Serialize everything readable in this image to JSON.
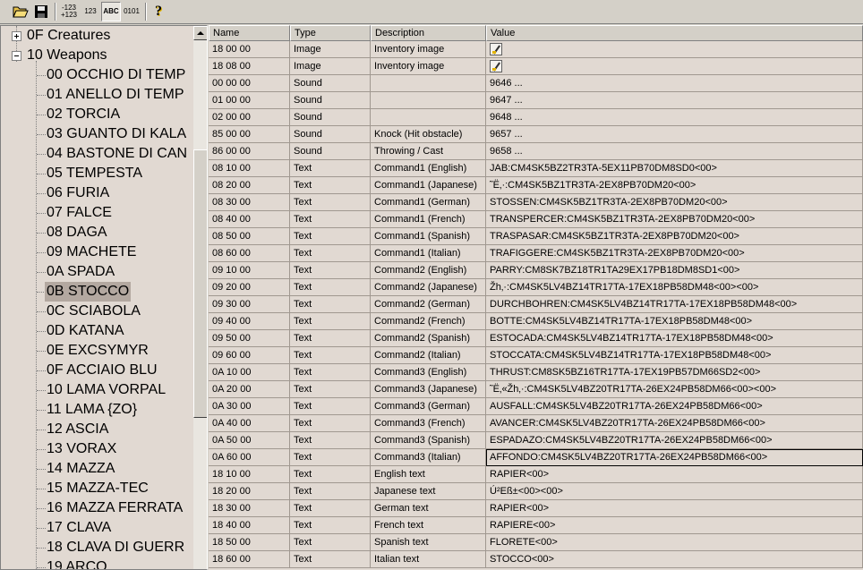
{
  "toolbar": {
    "open_icon": "folder-open-icon",
    "save_icon": "floppy-disk-icon",
    "signed_label_top": "-123",
    "signed_label_bottom": "+123",
    "decimal_label": "123",
    "text_label": "ABC",
    "binary_label": "0101",
    "help_label": "?"
  },
  "tree": {
    "items": [
      {
        "label": "0F Creatures",
        "level": 0,
        "expander": "+"
      },
      {
        "label": "10 Weapons",
        "level": 0,
        "expander": "-"
      },
      {
        "label": "00 OCCHIO DI TEMP",
        "level": 1
      },
      {
        "label": "01 ANELLO DI TEMP",
        "level": 1
      },
      {
        "label": "02 TORCIA",
        "level": 1
      },
      {
        "label": "03 GUANTO DI KALA",
        "level": 1
      },
      {
        "label": "04 BASTONE DI CAN",
        "level": 1
      },
      {
        "label": "05 TEMPESTA",
        "level": 1
      },
      {
        "label": "06 FURIA",
        "level": 1
      },
      {
        "label": "07 FALCE",
        "level": 1
      },
      {
        "label": "08 DAGA",
        "level": 1
      },
      {
        "label": "09 MACHETE",
        "level": 1
      },
      {
        "label": "0A SPADA",
        "level": 1
      },
      {
        "label": "0B STOCCO",
        "level": 1,
        "selected": true
      },
      {
        "label": "0C SCIABOLA",
        "level": 1
      },
      {
        "label": "0D KATANA",
        "level": 1
      },
      {
        "label": "0E EXCSYMYR",
        "level": 1
      },
      {
        "label": "0F ACCIAIO BLU",
        "level": 1
      },
      {
        "label": "10 LAMA VORPAL",
        "level": 1
      },
      {
        "label": "11 LAMA {ZO}",
        "level": 1
      },
      {
        "label": "12 ASCIA",
        "level": 1
      },
      {
        "label": "13 VORAX",
        "level": 1
      },
      {
        "label": "14 MAZZA",
        "level": 1
      },
      {
        "label": "15 MAZZA-TEC",
        "level": 1
      },
      {
        "label": "16 MAZZA FERRATA",
        "level": 1
      },
      {
        "label": "17 CLAVA",
        "level": 1
      },
      {
        "label": "18 CLAVA DI GUERR",
        "level": 1
      },
      {
        "label": "19 ARCO",
        "level": 1
      }
    ]
  },
  "grid": {
    "headers": [
      "Name",
      "Type",
      "Description",
      "Value"
    ],
    "rows": [
      {
        "name": "18 00 00",
        "type": "Image",
        "desc": "Inventory image",
        "value": "",
        "icon": "image-thumbnail-icon"
      },
      {
        "name": "18 08 00",
        "type": "Image",
        "desc": "Inventory image",
        "value": "",
        "icon": "image-thumbnail-icon"
      },
      {
        "name": "00 00 00",
        "type": "Sound",
        "desc": "",
        "value": "9646 ..."
      },
      {
        "name": "01 00 00",
        "type": "Sound",
        "desc": "",
        "value": "9647 ..."
      },
      {
        "name": "02 00 00",
        "type": "Sound",
        "desc": "",
        "value": "9648 ..."
      },
      {
        "name": "85 00 00",
        "type": "Sound",
        "desc": "Knock (Hit obstacle)",
        "value": "9657 ..."
      },
      {
        "name": "86 00 00",
        "type": "Sound",
        "desc": "Throwing / Cast",
        "value": "9658 ..."
      },
      {
        "name": "08 10 00",
        "type": "Text",
        "desc": "Command1 (English)",
        "value": "JAB:CM4SK5BZ2TR3TA-5EX11PB70DM8SD0<00>"
      },
      {
        "name": "08 20 00",
        "type": "Text",
        "desc": "Command1 (Japanese)",
        "value": "˜Ë‚·:CM4SK5BZ1TR3TA-2EX8PB70DM20<00>"
      },
      {
        "name": "08 30 00",
        "type": "Text",
        "desc": "Command1 (German)",
        "value": "STOSSEN:CM4SK5BZ1TR3TA-2EX8PB70DM20<00>"
      },
      {
        "name": "08 40 00",
        "type": "Text",
        "desc": "Command1 (French)",
        "value": "TRANSPERCER:CM4SK5BZ1TR3TA-2EX8PB70DM20<00>"
      },
      {
        "name": "08 50 00",
        "type": "Text",
        "desc": "Command1 (Spanish)",
        "value": "TRASPASAR:CM4SK5BZ1TR3TA-2EX8PB70DM20<00>"
      },
      {
        "name": "08 60 00",
        "type": "Text",
        "desc": "Command1 (Italian)",
        "value": "TRAFIGGERE:CM4SK5BZ1TR3TA-2EX8PB70DM20<00>"
      },
      {
        "name": "09 10 00",
        "type": "Text",
        "desc": "Command2 (English)",
        "value": "PARRY:CM8SK7BZ18TR1TA29EX17PB18DM8SD1<00>"
      },
      {
        "name": "09 20 00",
        "type": "Text",
        "desc": "Command2 (Japanese)",
        "value": "Žh‚·:CM4SK5LV4BZ14TR17TA-17EX18PB58DM48<00><00>"
      },
      {
        "name": "09 30 00",
        "type": "Text",
        "desc": "Command2 (German)",
        "value": "DURCHBOHREN:CM4SK5LV4BZ14TR17TA-17EX18PB58DM48<00>"
      },
      {
        "name": "09 40 00",
        "type": "Text",
        "desc": "Command2 (French)",
        "value": "BOTTE:CM4SK5LV4BZ14TR17TA-17EX18PB58DM48<00>"
      },
      {
        "name": "09 50 00",
        "type": "Text",
        "desc": "Command2 (Spanish)",
        "value": "ESTOCADA:CM4SK5LV4BZ14TR17TA-17EX18PB58DM48<00>"
      },
      {
        "name": "09 60 00",
        "type": "Text",
        "desc": "Command2 (Italian)",
        "value": "STOCCATA:CM4SK5LV4BZ14TR17TA-17EX18PB58DM48<00>"
      },
      {
        "name": "0A 10 00",
        "type": "Text",
        "desc": "Command3 (English)",
        "value": "THRUST:CM8SK5BZ16TR17TA-17EX19PB57DM66SD2<00>"
      },
      {
        "name": "0A 20 00",
        "type": "Text",
        "desc": "Command3 (Japanese)",
        "value": "˜Ë‚«Žh‚·:CM4SK5LV4BZ20TR17TA-26EX24PB58DM66<00><00>"
      },
      {
        "name": "0A 30 00",
        "type": "Text",
        "desc": "Command3 (German)",
        "value": "AUSFALL:CM4SK5LV4BZ20TR17TA-26EX24PB58DM66<00>"
      },
      {
        "name": "0A 40 00",
        "type": "Text",
        "desc": "Command3 (French)",
        "value": "AVANCER:CM4SK5LV4BZ20TR17TA-26EX24PB58DM66<00>"
      },
      {
        "name": "0A 50 00",
        "type": "Text",
        "desc": "Command3 (Spanish)",
        "value": "ESPADAZO:CM4SK5LV4BZ20TR17TA-26EX24PB58DM66<00>"
      },
      {
        "name": "0A 60 00",
        "type": "Text",
        "desc": "Command3 (Italian)",
        "value": "AFFONDO:CM4SK5LV4BZ20TR17TA-26EX24PB58DM66<00>",
        "focused": true
      },
      {
        "name": "18 10 00",
        "type": "Text",
        "desc": "English text",
        "value": "RAPIER<00>"
      },
      {
        "name": "18 20 00",
        "type": "Text",
        "desc": "Japanese text",
        "value": "Ú²Eß±<00><00>"
      },
      {
        "name": "18 30 00",
        "type": "Text",
        "desc": "German text",
        "value": "RAPIER<00>"
      },
      {
        "name": "18 40 00",
        "type": "Text",
        "desc": "French text",
        "value": "RAPIERE<00>"
      },
      {
        "name": "18 50 00",
        "type": "Text",
        "desc": "Spanish text",
        "value": "FLORETE<00>"
      },
      {
        "name": "18 60 00",
        "type": "Text",
        "desc": "Italian text",
        "value": "STOCCO<00>"
      }
    ]
  }
}
